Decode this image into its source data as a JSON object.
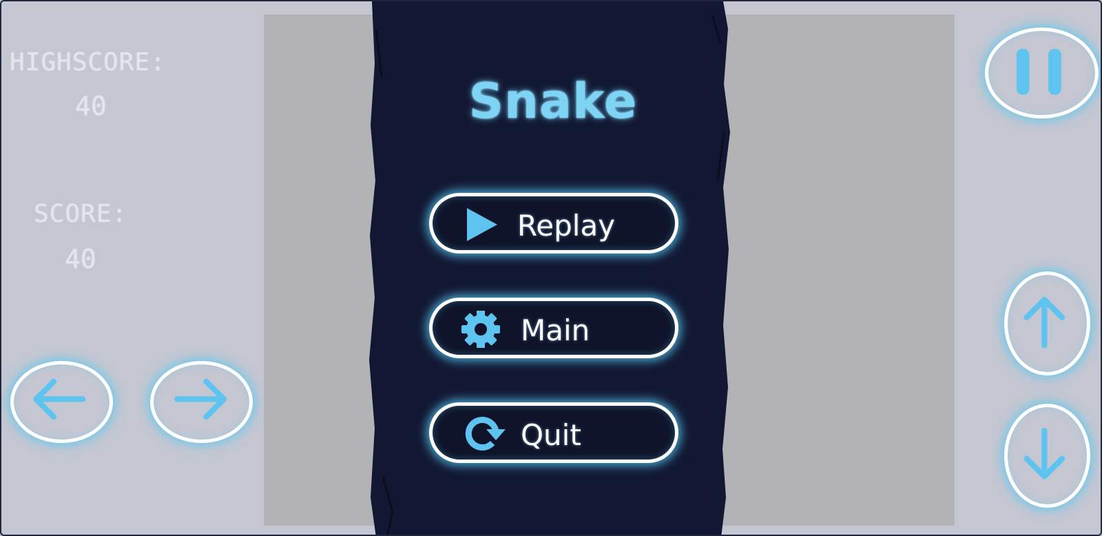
{
  "hud": {
    "highscore_label": "HIGHSCORE:",
    "highscore_value": "40",
    "score_label": "SCORE:",
    "score_value": "40"
  },
  "menu": {
    "title": "Snake",
    "replay_label": "Replay",
    "main_label": "Main",
    "quit_label": "Quit"
  },
  "icons": {
    "replay": "play-icon",
    "main": "gear-icon",
    "quit": "refresh-icon",
    "left": "arrow-left-icon",
    "right": "arrow-right-icon",
    "up": "arrow-up-icon",
    "down": "arrow-down-icon",
    "pause": "pause-icon"
  },
  "colors": {
    "accent": "#5ec4ef",
    "panel": "#121833",
    "glow": "#58c8f0"
  }
}
